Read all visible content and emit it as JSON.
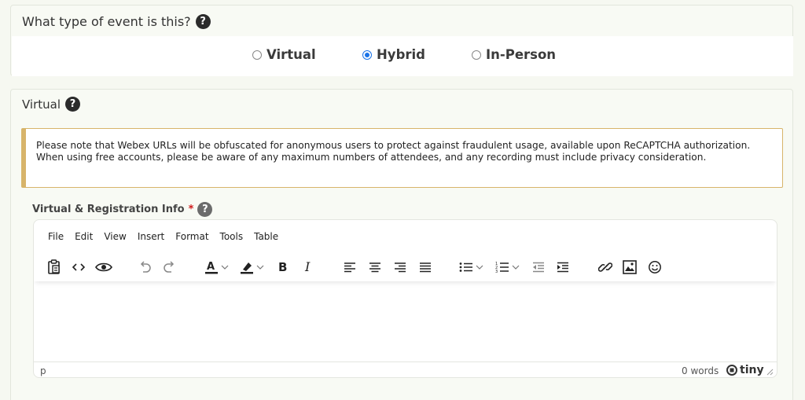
{
  "event_type": {
    "question": "What type of event is this?",
    "help": "?",
    "options": [
      {
        "label": "Virtual",
        "selected": false
      },
      {
        "label": "Hybrid",
        "selected": true
      },
      {
        "label": "In-Person",
        "selected": false
      }
    ]
  },
  "virtual": {
    "header": "Virtual",
    "help": "?",
    "notice": "Please note that Webex URLs will be obfuscated for anonymous users to protect against fraudulent usage, available upon ReCAPTCHA authorization. When using free accounts, please be aware of any maximum numbers of attendees, and any recording must include privacy consideration.",
    "field_label": "Virtual & Registration Info",
    "required_mark": "*",
    "field_help": "?"
  },
  "editor": {
    "menu": [
      "File",
      "Edit",
      "View",
      "Insert",
      "Format",
      "Tools",
      "Table"
    ],
    "content": "",
    "status_path": "p",
    "word_count": "0 words",
    "brand": "tiny"
  },
  "colors": {
    "accent": "#1a73e8",
    "notice_border": "#d7b46a",
    "required": "#d0191a"
  }
}
